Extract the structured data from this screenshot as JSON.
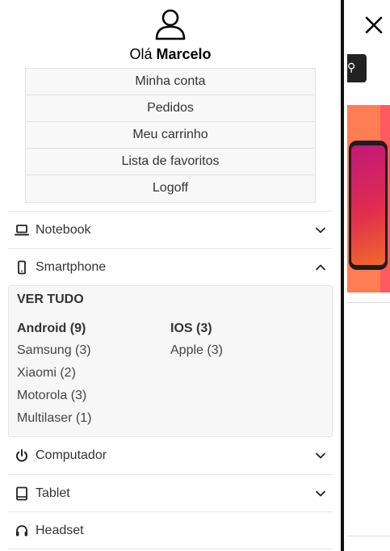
{
  "user": {
    "greeting_prefix": "Olá",
    "name": "Marcelo"
  },
  "account_menu": [
    "Minha conta",
    "Pedidos",
    "Meu carrinho",
    "Lista de favoritos",
    "Logoff"
  ],
  "categories": [
    {
      "label": "Notebook",
      "icon": "laptop-icon",
      "expanded": false
    },
    {
      "label": "Smartphone",
      "icon": "smartphone-icon",
      "expanded": true
    },
    {
      "label": "Computador",
      "icon": "power-icon",
      "expanded": false
    },
    {
      "label": "Tablet",
      "icon": "tablet-icon",
      "expanded": false
    },
    {
      "label": "Headset",
      "icon": "headset-icon",
      "expanded": false
    }
  ],
  "smartphone_submenu": {
    "see_all": "VER TUDO",
    "groups": [
      {
        "title": "Android (9)",
        "items": [
          "Samsung (3)",
          "Xiaomi (2)",
          "Motorola (3)",
          "Multilaser (1)"
        ]
      },
      {
        "title": "IOS (3)",
        "items": [
          "Apple (3)"
        ]
      }
    ]
  },
  "colors": {
    "drawer_border": "#111111",
    "banner": "#ff7d52",
    "submenu_bg": "#f7f7f7"
  }
}
